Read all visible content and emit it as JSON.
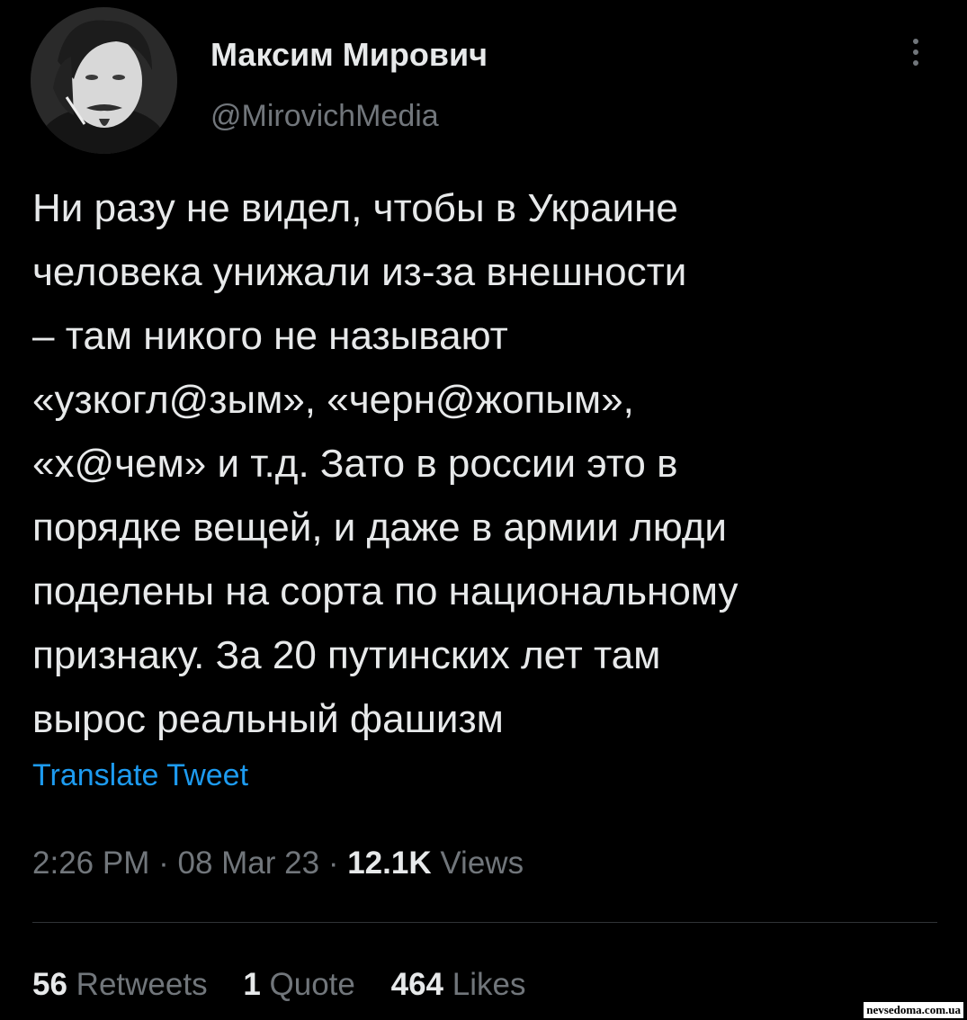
{
  "author": {
    "display_name": "Максим Мирович",
    "handle": "@MirovichMedia",
    "avatar_icon": "avatar-photo"
  },
  "tweet": {
    "lines": [
      "Ни разу не видел, чтобы в Украине",
      "человека унижали из-за внешности",
      "– там никого не называют",
      "«узкогл@зым», «черн@жопым»,",
      "«х@чем» и т.д. Зато в россии это в",
      "порядке вещей, и даже в армии люди",
      "поделены на сорта по национальному",
      "признаку. За 20 путинских лет там",
      "вырос реальный фашизм"
    ],
    "translate_label": "Translate Tweet"
  },
  "meta": {
    "time": "2:26 PM",
    "separator": "·",
    "date": "08 Mar 23",
    "views_count": "12.1K",
    "views_label": "Views"
  },
  "stats": {
    "retweets_count": "56",
    "retweets_label": "Retweets",
    "quotes_count": "1",
    "quotes_label": "Quote",
    "likes_count": "464",
    "likes_label": "Likes"
  },
  "watermark": "nevsedoma.com.ua",
  "colors": {
    "background": "#000000",
    "text_primary": "#e7e9ea",
    "text_secondary": "#71767b",
    "link": "#1d9bf0",
    "divider": "#2f3336"
  }
}
